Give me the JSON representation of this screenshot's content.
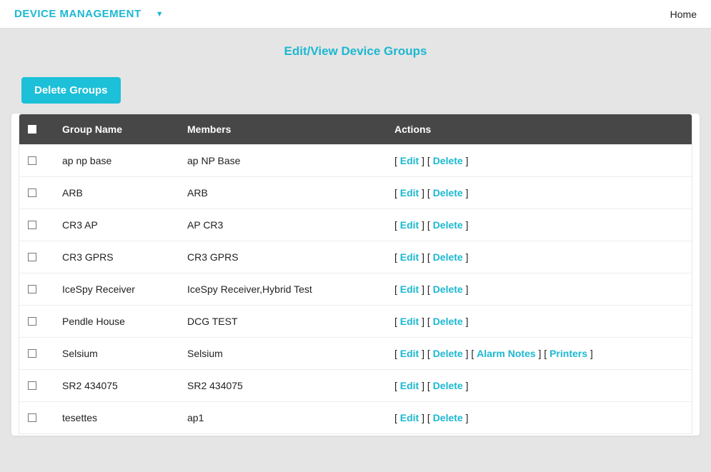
{
  "header": {
    "title": "DEVICE MANAGEMENT",
    "home": "Home"
  },
  "page": {
    "title": "Edit/View Device Groups",
    "delete_btn": "Delete Groups"
  },
  "table": {
    "headers": {
      "group_name": "Group Name",
      "members": "Members",
      "actions": "Actions"
    },
    "action_labels": {
      "edit": "Edit",
      "delete": "Delete",
      "alarm_notes": "Alarm Notes",
      "printers": "Printers"
    },
    "rows": [
      {
        "name": "ap np base",
        "members": "ap NP Base",
        "extra": false
      },
      {
        "name": "ARB",
        "members": "ARB",
        "extra": false
      },
      {
        "name": "CR3 AP",
        "members": "AP CR3",
        "extra": false
      },
      {
        "name": "CR3 GPRS",
        "members": "CR3 GPRS",
        "extra": false
      },
      {
        "name": "IceSpy Receiver",
        "members": "IceSpy Receiver,Hybrid Test",
        "extra": false
      },
      {
        "name": "Pendle House",
        "members": "DCG TEST",
        "extra": false
      },
      {
        "name": "Selsium",
        "members": "Selsium",
        "extra": true
      },
      {
        "name": "SR2 434075",
        "members": "SR2 434075",
        "extra": false
      },
      {
        "name": "tesettes",
        "members": "ap1",
        "extra": false
      }
    ]
  }
}
